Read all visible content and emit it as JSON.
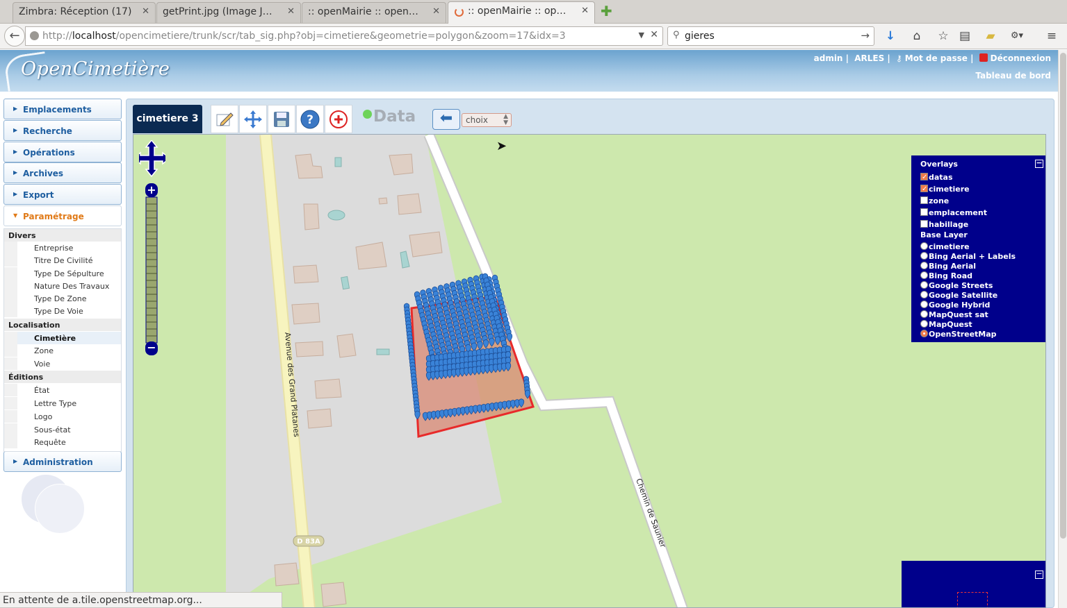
{
  "browser": {
    "tabs": [
      {
        "label": "Zimbra: Réception (17)",
        "icon": "zimbra-icon",
        "active": false
      },
      {
        "label": "getPrint.jpg (Image JPE...",
        "icon": "image-icon",
        "active": false
      },
      {
        "label": ":: openMairie :: openEx...",
        "icon": "page-icon",
        "active": false
      },
      {
        "label": ":: openMairie :: open...",
        "icon": "loading-icon",
        "active": true
      }
    ],
    "url_prefix": "http://",
    "url_host": "localhost",
    "url_path": "/opencimetiere/trunk/scr/tab_sig.php?obj=cimetiere&geometrie=polygon&zoom=17&idx=3",
    "search_value": "gieres",
    "status_text": "En attente de a.tile.openstreetmap.org..."
  },
  "header": {
    "logo": "OpenCimetière",
    "user": "admin",
    "collectivite": "ARLES",
    "password_link": "Mot de passe",
    "logout_link": "Déconnexion",
    "dashboard_link": "Tableau de bord"
  },
  "sidebar": {
    "menus": [
      "Emplacements",
      "Recherche",
      "Opérations",
      "Archives",
      "Export",
      "Paramétrage",
      "Administration"
    ],
    "parametrage": {
      "cat_divers": "Divers",
      "divers": [
        "Entreprise",
        "Titre De Civilité",
        "Type De Sépulture",
        "Nature Des Travaux",
        "Type De Zone",
        "Type De Voie"
      ],
      "cat_localisation": "Localisation",
      "localisation": [
        "Cimetière",
        "Zone",
        "Voie"
      ],
      "cat_editions": "Éditions",
      "editions": [
        "État",
        "Lettre Type",
        "Logo",
        "Sous-état",
        "Requête"
      ]
    }
  },
  "toolbar": {
    "map_name": "cimetiere 3",
    "data_label": "Data",
    "select_value": "choix",
    "icons": [
      "edit-icon",
      "move-icon",
      "save-icon",
      "help-icon",
      "add-point-icon",
      "back-arrow-icon"
    ]
  },
  "map": {
    "street_1": "Avenue des Grand Platanes",
    "street_2": "Chemin de Saunier",
    "road_badge": "D 83A",
    "layers": {
      "overlays_title": "Overlays",
      "overlays": [
        {
          "label": "datas",
          "checked": true
        },
        {
          "label": "cimetiere",
          "checked": true
        },
        {
          "label": "zone",
          "checked": false
        },
        {
          "label": "emplacement",
          "checked": false
        },
        {
          "label": "habillage",
          "checked": false
        }
      ],
      "base_title": "Base Layer",
      "base": [
        {
          "label": "cimetiere",
          "checked": false
        },
        {
          "label": "Bing Aerial + Labels",
          "checked": false
        },
        {
          "label": "Bing Aerial",
          "checked": false
        },
        {
          "label": "Bing Road",
          "checked": false
        },
        {
          "label": "Google Streets",
          "checked": false
        },
        {
          "label": "Google Satellite",
          "checked": false
        },
        {
          "label": "Google Hybrid",
          "checked": false
        },
        {
          "label": "MapQuest sat",
          "checked": false
        },
        {
          "label": "MapQuest",
          "checked": false
        },
        {
          "label": "OpenStreetMap",
          "checked": true
        }
      ]
    }
  },
  "colors": {
    "map_grass": "#cde8ad",
    "map_landuse": "#dcdcdc",
    "building": "#dfcfc4",
    "marker": "#3a83d8",
    "polygon_fill": "#d98a74",
    "polygon_stroke": "#e82a2a",
    "layer_panel": "#00008b"
  }
}
